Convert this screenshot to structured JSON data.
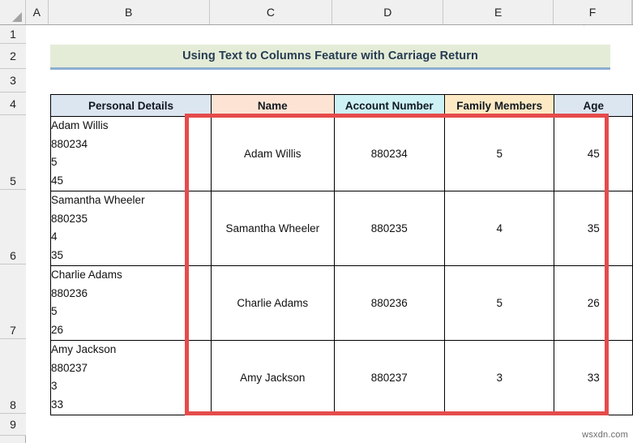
{
  "app": {
    "type": "spreadsheet",
    "watermark": "wsxdn.com"
  },
  "grid": {
    "column_headers": [
      "A",
      "B",
      "C",
      "D",
      "E",
      "F"
    ],
    "row_headers": [
      "1",
      "2",
      "3",
      "4",
      "5",
      "6",
      "7",
      "8",
      "9"
    ]
  },
  "title": {
    "text": "Using Text to Columns Feature with Carriage Return",
    "background": "#e4ecd7",
    "underline_color": "#8eaed0",
    "text_color": "#263b52"
  },
  "table": {
    "headers": [
      {
        "label": "Personal Details",
        "background": "#dce6f1"
      },
      {
        "label": "Name",
        "background": "#fce3d3"
      },
      {
        "label": "Account Number",
        "background": "#cdf2f5"
      },
      {
        "label": "Family Members",
        "background": "#fdeac4"
      },
      {
        "label": "Age",
        "background": "#dce6f1"
      }
    ],
    "rows": [
      {
        "personal_details": "Adam Willis\n880234\n5\n45",
        "name": "Adam Willis",
        "account_number": "880234",
        "family_members": "5",
        "age": "45"
      },
      {
        "personal_details": "Samantha Wheeler\n880235\n4\n35",
        "name": "Samantha Wheeler",
        "account_number": "880235",
        "family_members": "4",
        "age": "35"
      },
      {
        "personal_details": "Charlie Adams\n880236\n5\n26",
        "name": "Charlie Adams",
        "account_number": "880236",
        "family_members": "5",
        "age": "26"
      },
      {
        "personal_details": "Amy Jackson\n880237\n3\n33",
        "name": "Amy Jackson",
        "account_number": "880237",
        "family_members": "3",
        "age": "33"
      }
    ]
  },
  "highlight": {
    "color": "#e54b4b",
    "covers_columns": [
      "Name",
      "Account Number",
      "Family Members",
      "Age"
    ]
  }
}
